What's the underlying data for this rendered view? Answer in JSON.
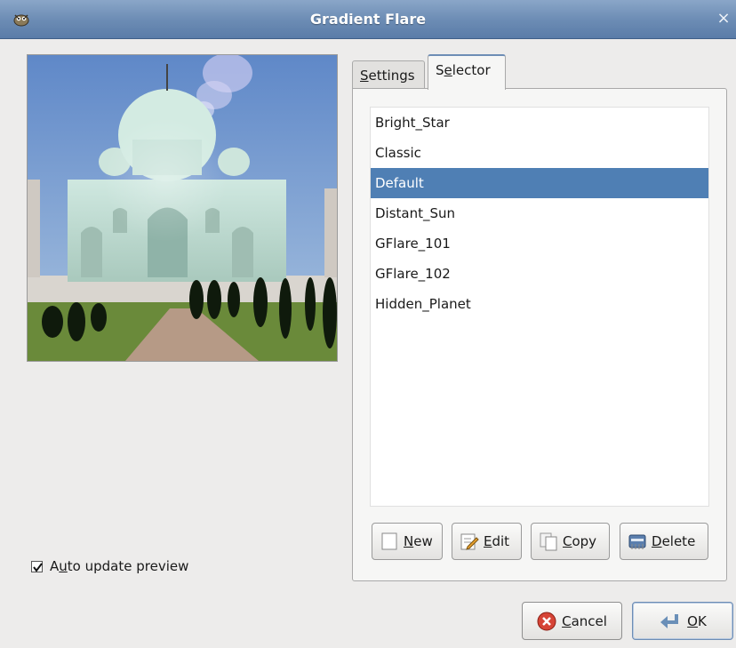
{
  "window": {
    "title": "Gradient Flare",
    "close_glyph": "×",
    "app_icon": "gimp-wilber-icon"
  },
  "tabs": [
    {
      "label_pre": "",
      "mnemonic": "S",
      "label_post": "ettings",
      "active": false
    },
    {
      "label_pre": "S",
      "mnemonic": "e",
      "label_post": "lector",
      "active": true
    }
  ],
  "flare_list": {
    "items": [
      "Bright_Star",
      "Classic",
      "Default",
      "Distant_Sun",
      "GFlare_101",
      "GFlare_102",
      "Hidden_Planet"
    ],
    "selected": "Default"
  },
  "tool_buttons": {
    "new": {
      "mnemonic": "N",
      "rest": "ew",
      "icon": "new-document-icon"
    },
    "edit": {
      "mnemonic": "E",
      "rest": "dit",
      "icon": "edit-pencil-icon"
    },
    "copy": {
      "mnemonic": "C",
      "rest": "opy",
      "icon": "copy-pages-icon"
    },
    "delete": {
      "mnemonic": "D",
      "rest": "elete",
      "icon": "delete-shredder-icon"
    }
  },
  "auto_update": {
    "checked": true,
    "label_pre": "A",
    "mnemonic": "u",
    "label_post": "to update preview"
  },
  "dialog_buttons": {
    "cancel": {
      "mnemonic": "C",
      "rest": "ancel",
      "icon": "cancel-icon"
    },
    "ok": {
      "mnemonic": "O",
      "rest": "K",
      "icon": "ok-return-icon"
    }
  },
  "colors": {
    "titlebar": "#6d8db5",
    "selection": "#4f7fb4",
    "cancel_red": "#d64436"
  }
}
